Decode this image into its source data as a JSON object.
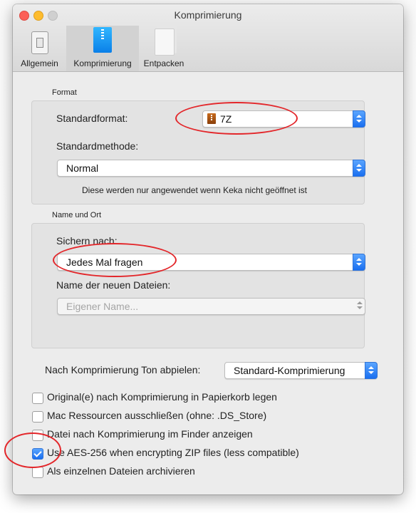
{
  "window": {
    "title": "Komprimierung"
  },
  "toolbar": {
    "tabs": [
      {
        "label": "Allgemein",
        "icon": "switch-icon"
      },
      {
        "label": "Komprimierung",
        "icon": "zip-archive-icon",
        "active": true
      },
      {
        "label": "Entpacken",
        "icon": "unzip-documents-icon"
      }
    ]
  },
  "format_group": {
    "title": "Format",
    "standard_format_label": "Standardformat:",
    "standard_format_value": "7Z",
    "standard_method_label": "Standardmethode:",
    "standard_method_value": "Normal",
    "note": "Diese werden nur angewendet wenn Keka nicht geöffnet ist"
  },
  "location_group": {
    "title": "Name und Ort",
    "save_to_label": "Sichern nach:",
    "save_to_value": "Jedes Mal fragen",
    "new_files_name_label": "Name der neuen Dateien:",
    "new_files_name_value": "Eigener Name..."
  },
  "sound": {
    "label": "Nach Komprimierung Ton abpielen:",
    "value": "Standard-Komprimierung"
  },
  "options": [
    {
      "label": "Original(e) nach Komprimierung in Papierkorb legen",
      "checked": false
    },
    {
      "label": "Mac Ressourcen ausschließen (ohne: .DS_Store)",
      "checked": false
    },
    {
      "label": "Datei nach Komprimierung im Finder anzeigen",
      "checked": false
    },
    {
      "label": "Use AES-256 when encrypting ZIP files (less compatible)",
      "checked": true
    },
    {
      "label": "Als einzelnen Dateien archivieren",
      "checked": false
    }
  ],
  "colors": {
    "accent": "#1a6ff0",
    "annotation": "#e3262a"
  }
}
